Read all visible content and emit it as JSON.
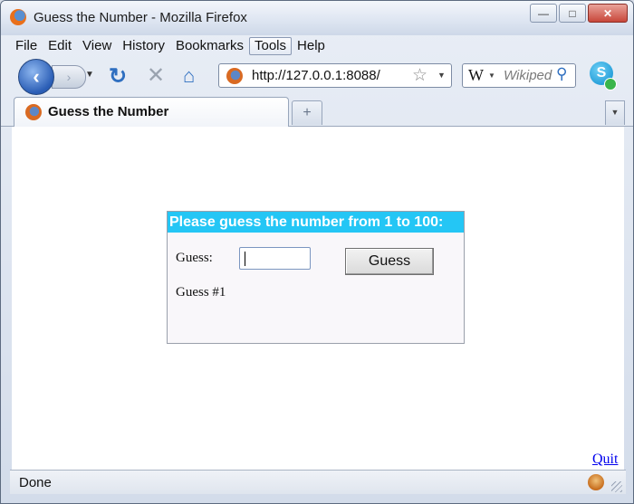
{
  "window": {
    "title": "Guess the Number - Mozilla Firefox"
  },
  "window_controls": {
    "minimize": "—",
    "maximize": "□",
    "close": "✕"
  },
  "menu": {
    "items": [
      {
        "label": "File"
      },
      {
        "label": "Edit"
      },
      {
        "label": "View"
      },
      {
        "label": "History"
      },
      {
        "label": "Bookmarks"
      },
      {
        "label": "Tools"
      },
      {
        "label": "Help"
      }
    ]
  },
  "nav": {
    "back_icon": "‹",
    "forward_icon": "›",
    "history_drop_icon": "▼",
    "reload_icon": "↻",
    "stop_icon": "✕",
    "home_icon": "⌂",
    "url": "http://127.0.0.1:8088/",
    "star_icon": "☆",
    "url_drop_icon": "▼",
    "search_engine_icon": "W",
    "search_drop_icon": "▼",
    "search_placeholder": "Wikiped",
    "search_icon": "⚲",
    "skype_icon": "S"
  },
  "tabs": {
    "items": [
      {
        "label": "Guess the Number"
      }
    ],
    "new_tab_icon": "+",
    "tab_list_icon": "▼"
  },
  "page": {
    "header": "Please guess the number from 1 to 100:",
    "guess_label": "Guess:",
    "guess_input_value": "",
    "guess_button": "Guess",
    "guess_count": "Guess #1",
    "quit_link": "Quit",
    "colors": {
      "header_bg": "#24c6f5",
      "header_text": "#ffffff",
      "link": "#0000ee"
    }
  },
  "status": {
    "text": "Done"
  }
}
